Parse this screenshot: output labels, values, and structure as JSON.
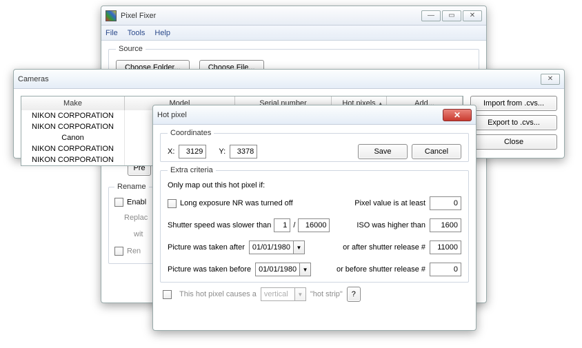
{
  "main": {
    "title": "Pixel Fixer",
    "menus": [
      "File",
      "Tools",
      "Help"
    ],
    "source": {
      "legend": "Source",
      "choose_folder": "Choose Folder...",
      "choose_file": "Choose File..."
    },
    "pref_radio": "Pre",
    "pref_btn": "Pre",
    "rename": {
      "legend": "Rename",
      "enable": "Enabl",
      "replace": "Replac",
      "with": "wit",
      "ren": "Ren"
    }
  },
  "cameras": {
    "title": "Cameras",
    "columns": {
      "make": "Make",
      "model": "Model",
      "serial": "Serial number",
      "hot": "Hot pixels",
      "add": "Add..."
    },
    "rows": [
      {
        "make": "NIKON CORPORATION"
      },
      {
        "make": "NIKON CORPORATION"
      },
      {
        "make": "Canon"
      },
      {
        "make": "NIKON CORPORATION"
      },
      {
        "make": "NIKON CORPORATION"
      }
    ],
    "buttons": {
      "import": "Import from .cvs...",
      "export": "Export to .cvs...",
      "close": "Close"
    }
  },
  "hotpixel": {
    "title": "Hot pixel",
    "coords": {
      "legend": "Coordinates",
      "x_label": "X:",
      "x": "3129",
      "y_label": "Y:",
      "y": "3378",
      "save": "Save",
      "cancel": "Cancel"
    },
    "extra": {
      "legend": "Extra criteria",
      "only_if": "Only map out this hot pixel if:",
      "long_nr": "Long exposure NR was turned off",
      "pixel_value_label": "Pixel value is at least",
      "pixel_value": "0",
      "shutter_label": "Shutter speed was slower than",
      "shutter_num": "1",
      "shutter_sep": "/",
      "shutter_den": "16000",
      "iso_label": "ISO was higher than",
      "iso": "1600",
      "taken_after_label": "Picture was taken after",
      "taken_after_date": "01/01/1980",
      "after_release_label": "or after shutter release #",
      "after_release": "11000",
      "taken_before_label": "Picture was taken before",
      "taken_before_date": "01/01/1980",
      "before_release_label": "or before shutter release #",
      "before_release": "0"
    },
    "strip": {
      "label_pre": "This hot pixel causes a",
      "direction": "vertical",
      "label_post": "\"hot strip\"",
      "help": "?"
    }
  }
}
